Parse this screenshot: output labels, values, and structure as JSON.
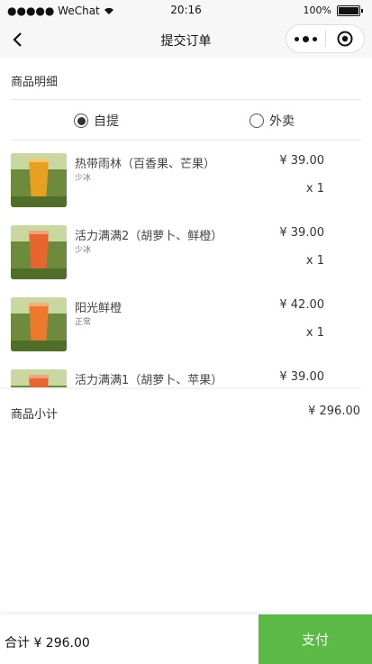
{
  "status_bar": {
    "carrier": "●●●●● WeChat",
    "time": "20:16",
    "battery": "100%"
  },
  "nav": {
    "title": "提交订单",
    "back_icon": "chevron-left-icon",
    "more_icon": "more-dots-icon",
    "target_icon": "target-icon"
  },
  "section_title": "商品明细",
  "delivery": {
    "options": [
      {
        "label": "自提",
        "checked": true
      },
      {
        "label": "外卖",
        "checked": false
      }
    ]
  },
  "items": [
    {
      "name": "热带雨林（百香果、芒果）",
      "note": "少冰",
      "price": "¥ 39.00",
      "qty": "x 1",
      "color": "#e8a020"
    },
    {
      "name": "活力满满2（胡萝卜、鲜橙）",
      "note": "少冰",
      "price": "¥ 39.00",
      "qty": "x 1",
      "color": "#e8652f"
    },
    {
      "name": "阳光鲜橙",
      "note": "正常",
      "price": "¥ 42.00",
      "qty": "x 1",
      "color": "#ec7a2c"
    },
    {
      "name": "活力满满1（胡萝卜、苹果）",
      "note": "",
      "price": "¥ 39.00",
      "qty": "",
      "color": "#e8652f"
    }
  ],
  "subtotal": {
    "label": "商品小计",
    "value": "¥ 296.00"
  },
  "footer": {
    "total_label": "合计 ¥ 296.00",
    "pay_label": "支付",
    "pay_color": "#5bba46"
  }
}
